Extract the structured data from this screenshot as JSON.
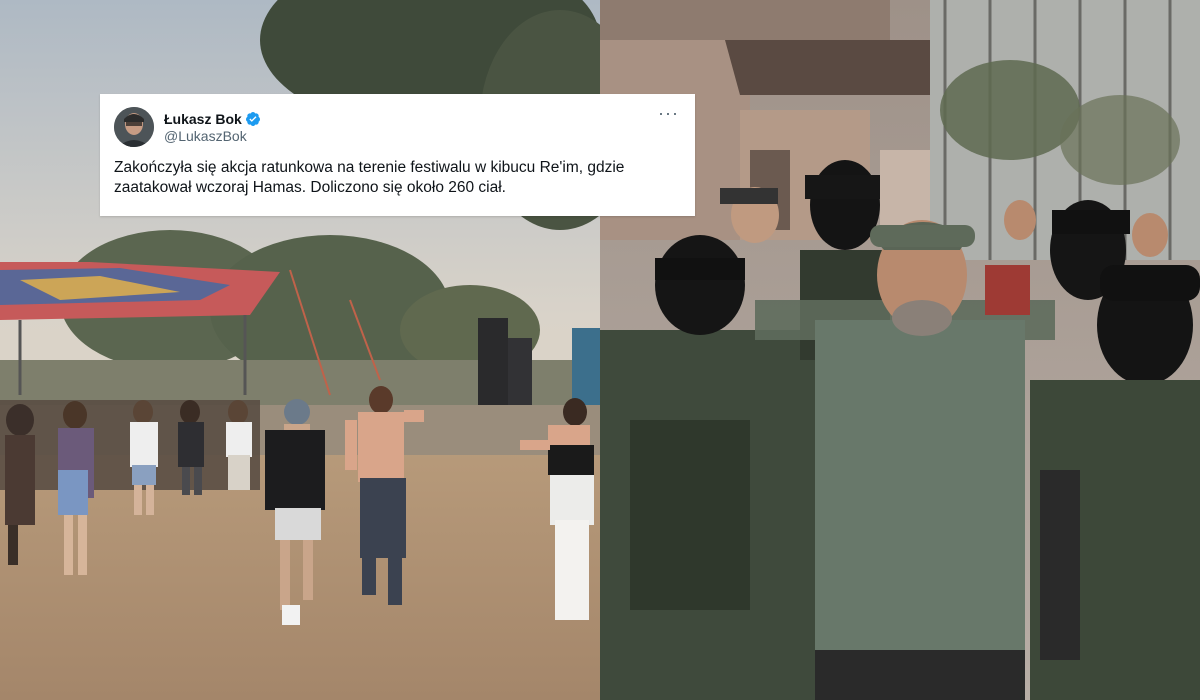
{
  "tweet": {
    "display_name": "Łukasz Bok",
    "handle": "@LukaszBok",
    "text": "Zakończyła się akcja ratunkowa na terenie festiwalu w kibucu Re'im, gdzie zaatakował wczoraj Hamas. Doliczono się około 260 ciał.",
    "more_icon": "more-horizontal-icon",
    "verified_icon": "verified-badge-icon",
    "verified_color": "#1d9bf0"
  },
  "photos": {
    "left_alt_icon": "festival-photo",
    "right_alt_icon": "group-photo"
  },
  "colors": {
    "text_primary": "#0f1419",
    "text_secondary": "#536471"
  }
}
